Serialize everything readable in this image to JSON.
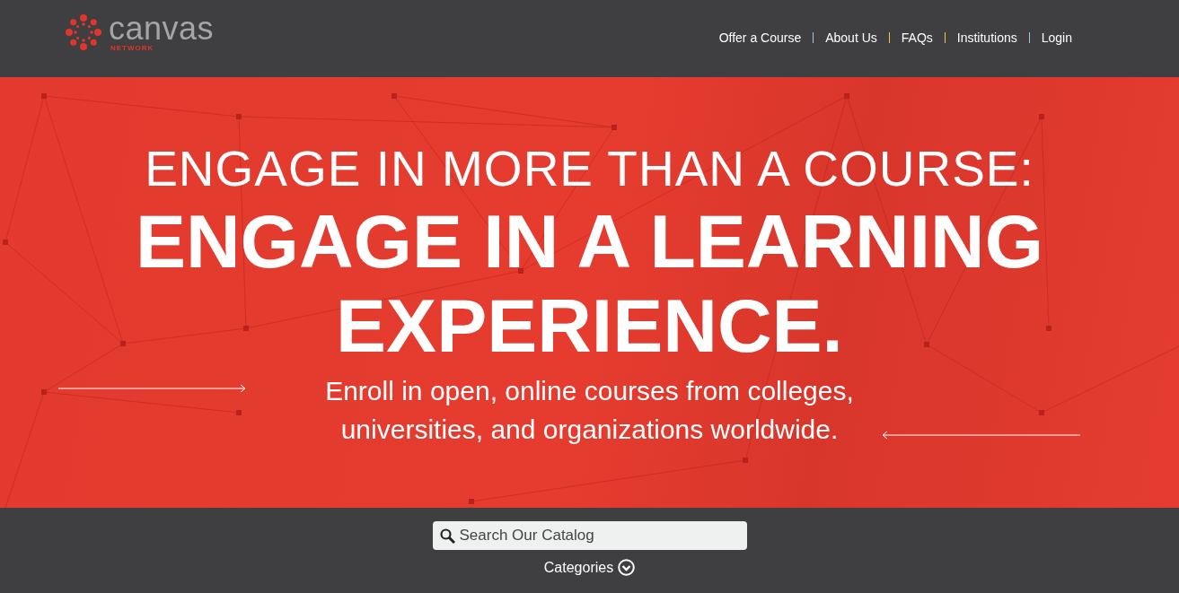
{
  "header": {
    "logo": {
      "wordmark": "canvas",
      "subtitle": "NETWORK"
    },
    "nav": [
      {
        "label": "Offer a Course"
      },
      {
        "label": "About Us"
      },
      {
        "label": "FAQs"
      },
      {
        "label": "Institutions"
      },
      {
        "label": "Login"
      }
    ]
  },
  "hero": {
    "headline": "ENGAGE IN MORE THAN A COURSE:",
    "tagline": [
      "ENGAGE IN A LEARNING",
      "EXPERIENCE."
    ],
    "description": "Enroll in open, online courses from colleges,\nuniversities, and organizations worldwide."
  },
  "search": {
    "placeholder": "Search Our Catalog"
  },
  "categories": {
    "label": "Categories"
  }
}
